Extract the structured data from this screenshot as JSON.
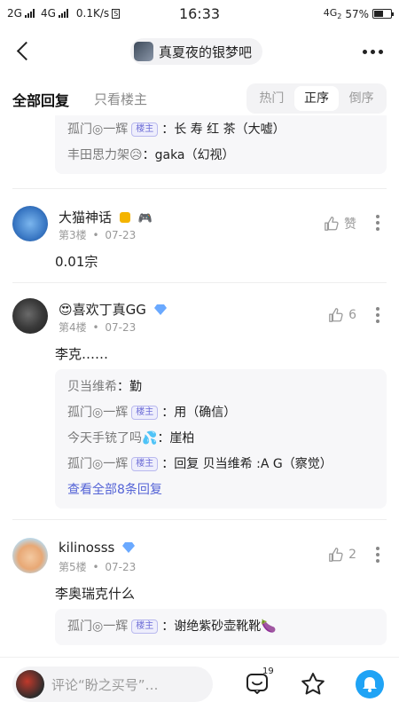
{
  "status_bar": {
    "network_1": "2G",
    "network_2": "4G",
    "speed": "0.1K/s",
    "s_badge": "S",
    "time": "16:33",
    "network_3": "4G",
    "network_3_sub": "2",
    "battery": "57%",
    "battery_level": 0.57
  },
  "header": {
    "forum_name": "真夏夜的银梦吧"
  },
  "tabs": {
    "all_replies": "全部回复",
    "op_only": "只看楼主"
  },
  "sort": {
    "options": [
      "热门",
      "正序",
      "倒序"
    ],
    "selected": "正序"
  },
  "top_subreplies": [
    {
      "user": "孤门◎一辉",
      "badge": "楼主",
      "text": "长 寿 红 茶（大嘘）"
    },
    {
      "user": "丰田思力架😥",
      "badge": "",
      "text": "gaka（幻视）"
    }
  ],
  "posts": [
    {
      "user": "大猫神话",
      "icons": [
        "👎",
        "🎮"
      ],
      "floor": "第3楼",
      "dot": "•",
      "date": "07-23",
      "like_label": "赞",
      "text": "0.01宗"
    },
    {
      "user": "😍喜欢丁真GG",
      "floor": "第4楼",
      "dot": "•",
      "date": "07-23",
      "like_label": "6",
      "text": "李克……",
      "subreplies": [
        {
          "user": "贝当维希",
          "badge": "",
          "text": "勤"
        },
        {
          "user": "孤门◎一辉",
          "badge": "楼主",
          "text": "用（确信）"
        },
        {
          "user": "今天手铳了吗💦",
          "badge": "",
          "text": "崖柏"
        },
        {
          "user": "孤门◎一辉",
          "badge": "楼主",
          "text": "回复 贝当维希 :A G（察觉）"
        }
      ],
      "view_all": "查看全部8条回复"
    },
    {
      "user": "kilinosss",
      "floor": "第5楼",
      "dot": "•",
      "date": "07-23",
      "like_label": "2",
      "text": "李奥瑞克什么",
      "subreplies": [
        {
          "user": "孤门◎一辉",
          "badge": "楼主",
          "text": "谢绝紫砂壶靴靴🍆"
        }
      ]
    }
  ],
  "bottom": {
    "comment_placeholder": "评论“盼之买号”…",
    "reply_count": "19"
  }
}
